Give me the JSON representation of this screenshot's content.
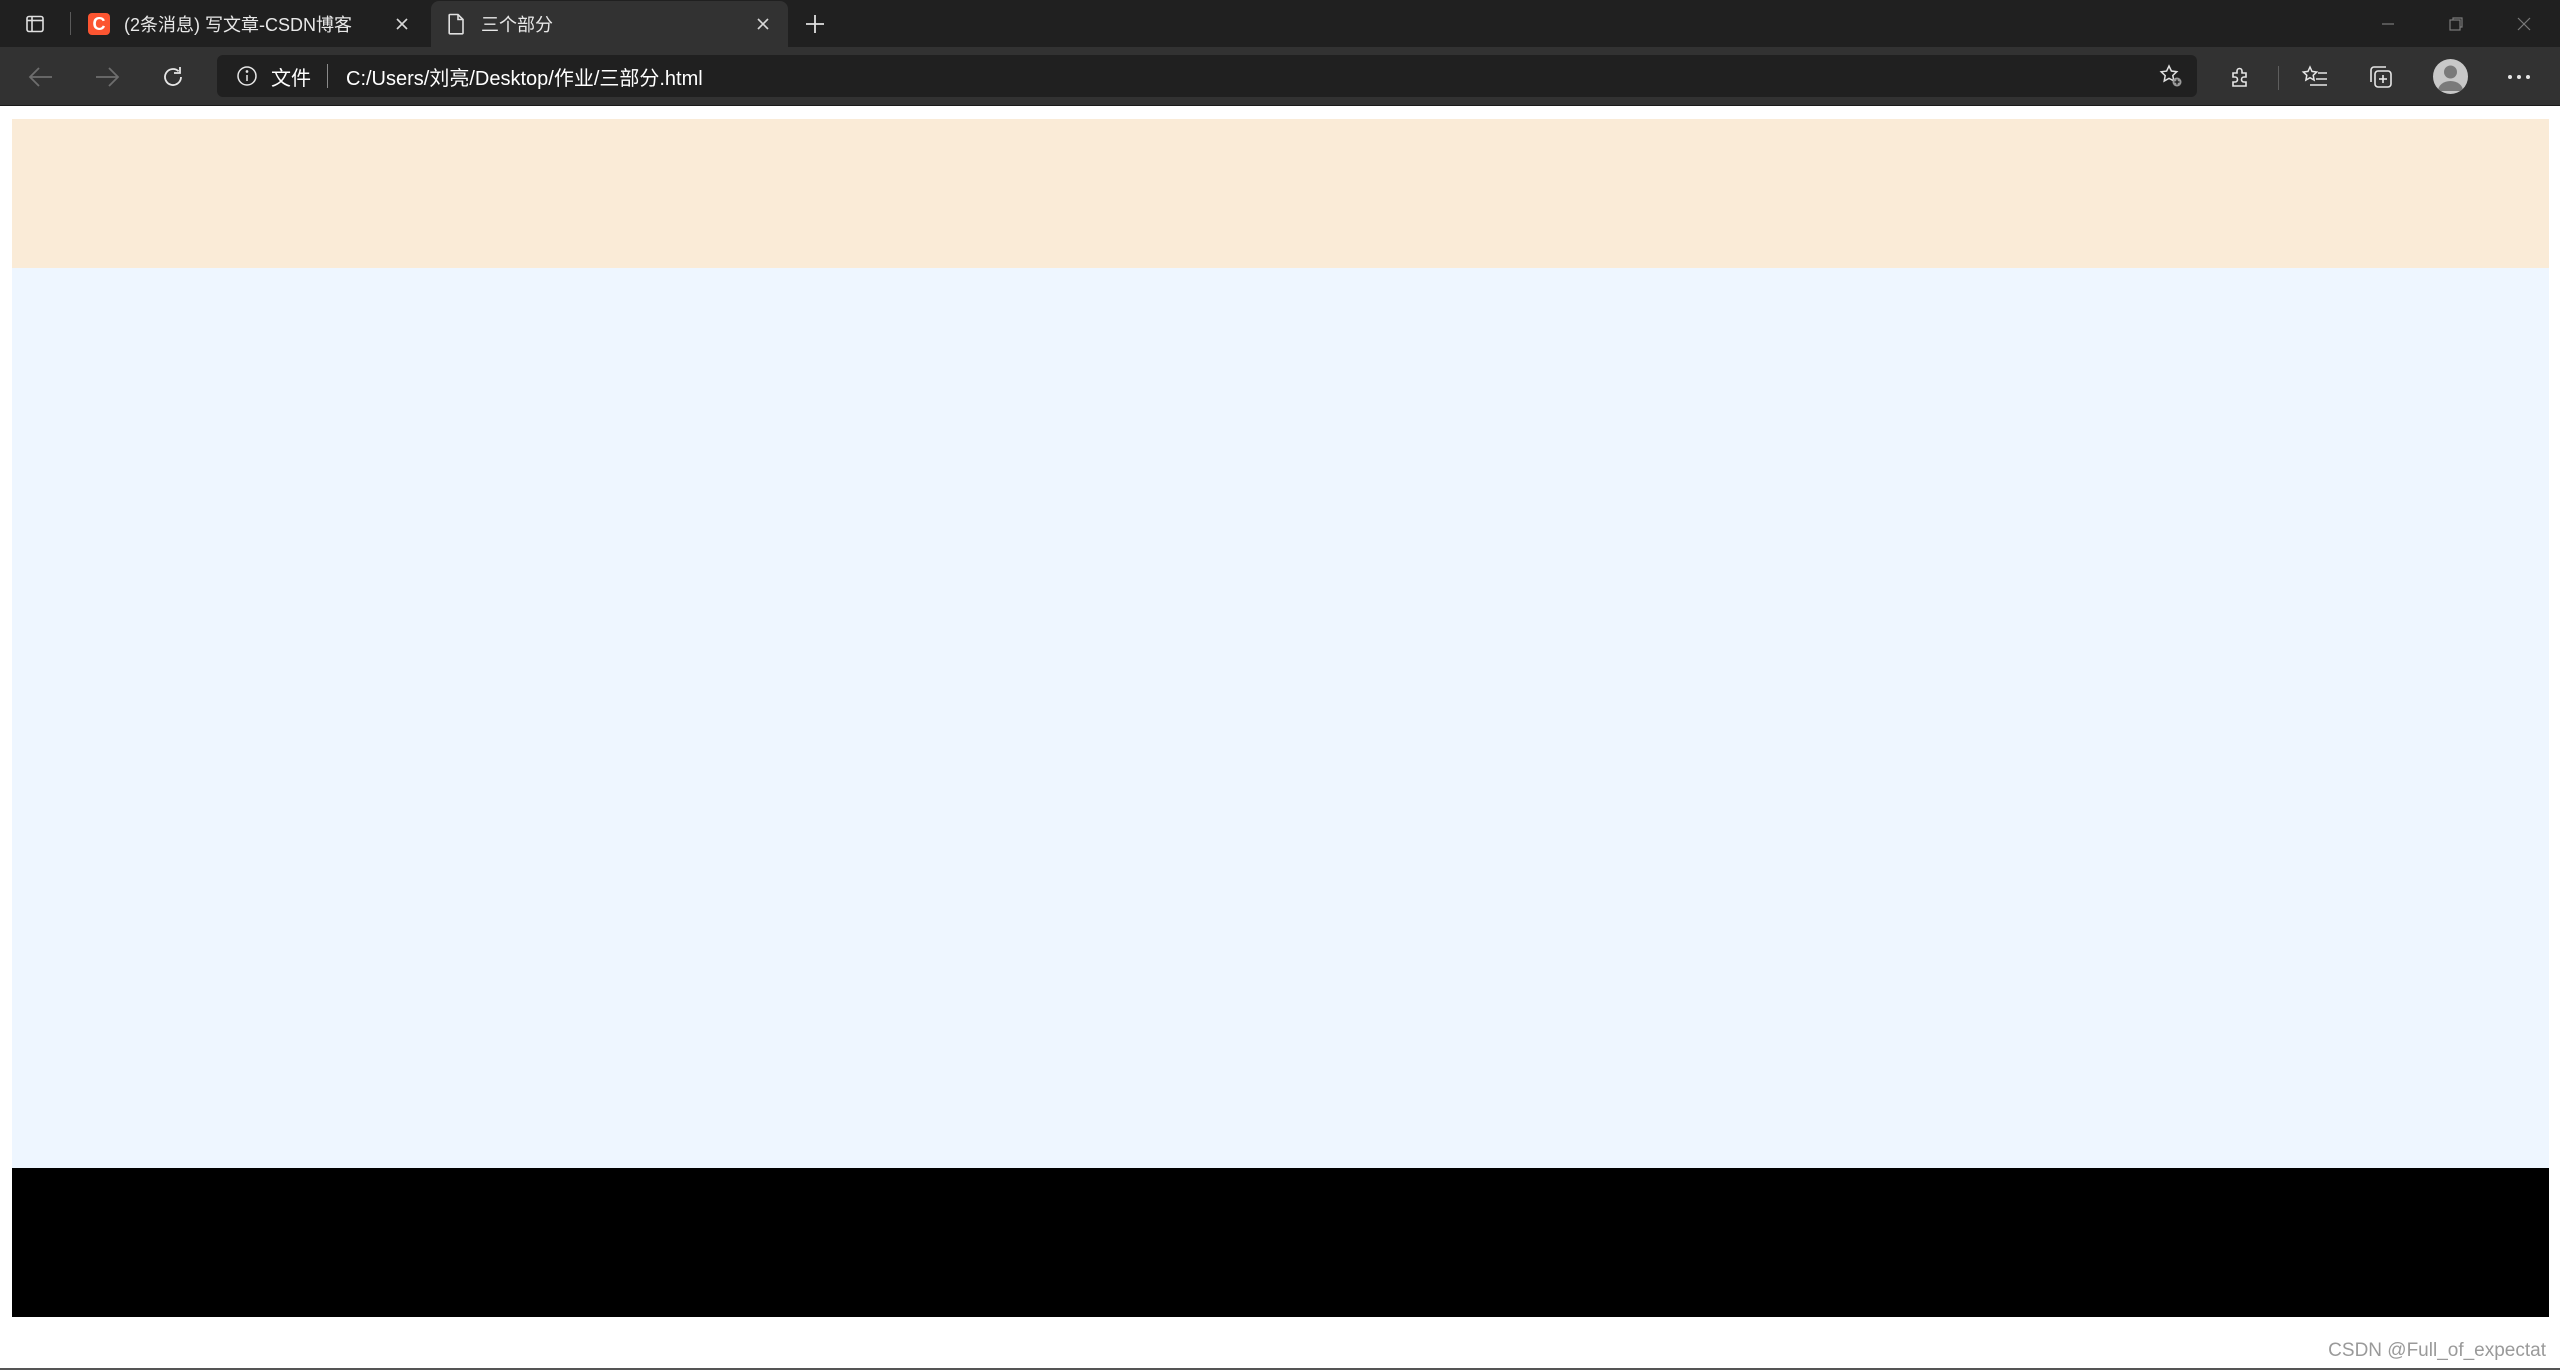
{
  "browser": {
    "tabs": [
      {
        "title": "(2条消息) 写文章-CSDN博客",
        "favicon": "csdn-logo",
        "favicon_letter": "C",
        "active": false
      },
      {
        "title": "三个部分",
        "favicon": "file-icon",
        "active": true
      }
    ],
    "address": {
      "scheme_label": "文件",
      "url": "C:/Users/刘亮/Desktop/作业/三部分.html"
    },
    "icons": {
      "tab_actions": "tab-actions-icon",
      "new_tab": "plus-icon",
      "back": "arrow-left-icon",
      "forward": "arrow-right-icon",
      "refresh": "refresh-icon",
      "site_info": "info-icon",
      "add_favorite": "star-plus-icon",
      "extensions": "puzzle-icon",
      "favorites": "favorites-star-icon",
      "collections": "collections-icon",
      "profile": "avatar",
      "more": "ellipsis-icon",
      "minimize": "minimize-icon",
      "restore": "restore-icon",
      "close": "close-icon"
    }
  },
  "page": {
    "sections": [
      {
        "name": "header",
        "color": "#faebd7"
      },
      {
        "name": "main",
        "color": "#eef6ff"
      },
      {
        "name": "footer",
        "color": "#000000"
      }
    ]
  },
  "watermark": "CSDN @Full_of_expectat",
  "colors": {
    "titlebar": "#202020",
    "toolbar": "#323232",
    "address_bg": "#202020",
    "csdn_brand": "#fc5531"
  }
}
